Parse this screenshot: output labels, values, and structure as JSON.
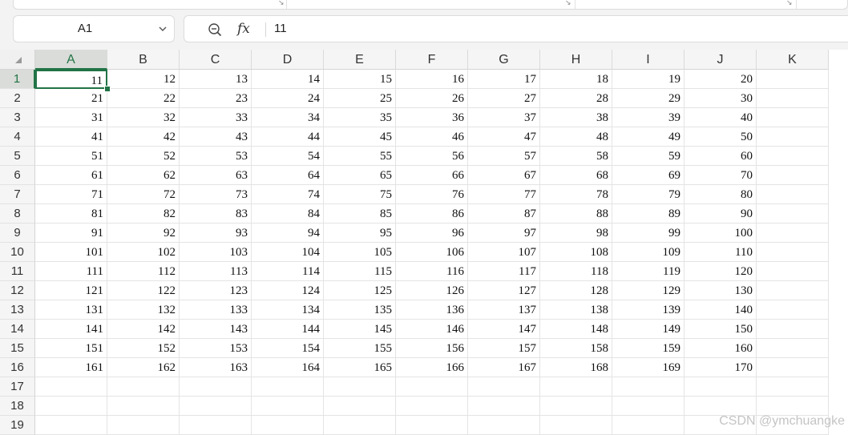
{
  "name_box": {
    "value": "A1"
  },
  "formula_bar": {
    "value": "11"
  },
  "icons": {
    "zoom": "zoom-out-icon",
    "fx": "fx",
    "name_box_caret": "chevron-down-icon",
    "select_all": "select-all-triangle-icon",
    "dialog_launcher": "↘"
  },
  "colors": {
    "accent": "#217346",
    "grid_line": "#e4e4e4",
    "header_bg": "#f5f5f5"
  },
  "grid": {
    "columns": [
      "A",
      "B",
      "C",
      "D",
      "E",
      "F",
      "G",
      "H",
      "I",
      "J",
      "K"
    ],
    "rows": [
      "1",
      "2",
      "3",
      "4",
      "5",
      "6",
      "7",
      "8",
      "9",
      "10",
      "11",
      "12",
      "13",
      "14",
      "15",
      "16",
      "17",
      "18",
      "19"
    ],
    "selected_cell": "A1",
    "data": [
      [
        "11",
        "12",
        "13",
        "14",
        "15",
        "16",
        "17",
        "18",
        "19",
        "20"
      ],
      [
        "21",
        "22",
        "23",
        "24",
        "25",
        "26",
        "27",
        "28",
        "29",
        "30"
      ],
      [
        "31",
        "32",
        "33",
        "34",
        "35",
        "36",
        "37",
        "38",
        "39",
        "40"
      ],
      [
        "41",
        "42",
        "43",
        "44",
        "45",
        "46",
        "47",
        "48",
        "49",
        "50"
      ],
      [
        "51",
        "52",
        "53",
        "54",
        "55",
        "56",
        "57",
        "58",
        "59",
        "60"
      ],
      [
        "61",
        "62",
        "63",
        "64",
        "65",
        "66",
        "67",
        "68",
        "69",
        "70"
      ],
      [
        "71",
        "72",
        "73",
        "74",
        "75",
        "76",
        "77",
        "78",
        "79",
        "80"
      ],
      [
        "81",
        "82",
        "83",
        "84",
        "85",
        "86",
        "87",
        "88",
        "89",
        "90"
      ],
      [
        "91",
        "92",
        "93",
        "94",
        "95",
        "96",
        "97",
        "98",
        "99",
        "100"
      ],
      [
        "101",
        "102",
        "103",
        "104",
        "105",
        "106",
        "107",
        "108",
        "109",
        "110"
      ],
      [
        "111",
        "112",
        "113",
        "114",
        "115",
        "116",
        "117",
        "118",
        "119",
        "120"
      ],
      [
        "121",
        "122",
        "123",
        "124",
        "125",
        "126",
        "127",
        "128",
        "129",
        "130"
      ],
      [
        "131",
        "132",
        "133",
        "134",
        "135",
        "136",
        "137",
        "138",
        "139",
        "140"
      ],
      [
        "141",
        "142",
        "143",
        "144",
        "145",
        "146",
        "147",
        "148",
        "149",
        "150"
      ],
      [
        "151",
        "152",
        "153",
        "154",
        "155",
        "156",
        "157",
        "158",
        "159",
        "160"
      ],
      [
        "161",
        "162",
        "163",
        "164",
        "165",
        "166",
        "167",
        "168",
        "169",
        "170"
      ]
    ]
  },
  "watermark": "CSDN @ymchuangke"
}
